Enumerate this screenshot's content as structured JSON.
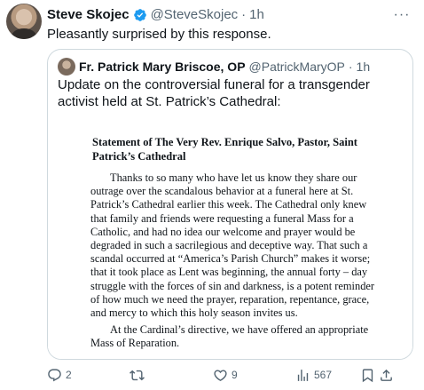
{
  "post": {
    "author_name": "Steve Skojec",
    "handle": "@SteveSkojec",
    "separator": "·",
    "time": "1h",
    "text": "Pleasantly surprised by this response.",
    "more_label": "···"
  },
  "quoted_post": {
    "author_name": "Fr. Patrick Mary Briscoe, OP",
    "handle": "@PatrickMaryOP",
    "separator": "·",
    "time": "1h",
    "text": "Update on the controversial funeral for a transgender activist held at St. Patrick’s Cathedral:",
    "document": {
      "title": "Statement of The Very Rev. Enrique Salvo, Pastor, Saint Patrick’s Cathedral",
      "paragraph_1": "Thanks to so many who have let us know they share our outrage over the scandalous behavior at a funeral here at St. Patrick’s Cathedral earlier this week. The Cathedral only knew that family and friends were requesting a funeral Mass for a Catholic, and had no idea our welcome and prayer would be degraded in such a sacrilegious and deceptive way. That such a scandal occurred at “America’s Parish Church” makes it worse; that it took place as Lent was beginning, the annual forty – day struggle with the forces of sin and darkness, is a potent reminder of how much we need the prayer, reparation, repentance, grace, and mercy to which this holy season invites us.",
      "paragraph_2": "At the Cardinal’s directive, we have offered an appropriate Mass of Reparation."
    }
  },
  "actions": {
    "replies": "2",
    "reposts": "",
    "likes": "9",
    "views": "567"
  },
  "colors": {
    "verified": "#1d9bf0",
    "secondary_text": "#536471",
    "border": "#cfd9de"
  }
}
